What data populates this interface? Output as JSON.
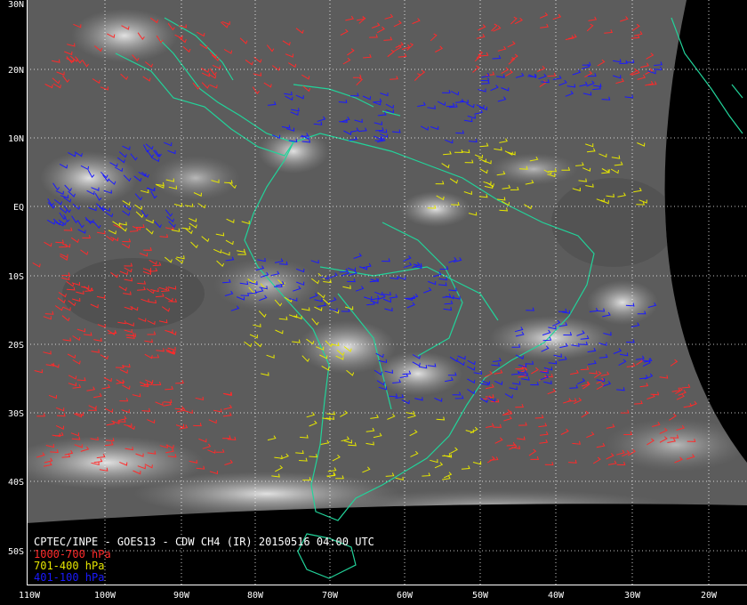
{
  "title": "CPTEC/INPE - GOES13 - CDW CH4 (IR) 20150516 04:00 UTC",
  "legend": [
    {
      "label": "1000-700 hPa",
      "color": "#ff2a2a"
    },
    {
      "label": "701-400 hPa",
      "color": "#e6e600"
    },
    {
      "label": "401-100 hPa",
      "color": "#1a1aff"
    }
  ],
  "coastline_color": "#22d39a",
  "grid_color": "#ffffff",
  "lat_labels": [
    "30N",
    "20N",
    "10N",
    "EQ",
    "10S",
    "20S",
    "30S",
    "40S",
    "50S"
  ],
  "lon_labels": [
    "110W",
    "100W",
    "90W",
    "80W",
    "70W",
    "60W",
    "50W",
    "40W",
    "30W",
    "20W"
  ]
}
